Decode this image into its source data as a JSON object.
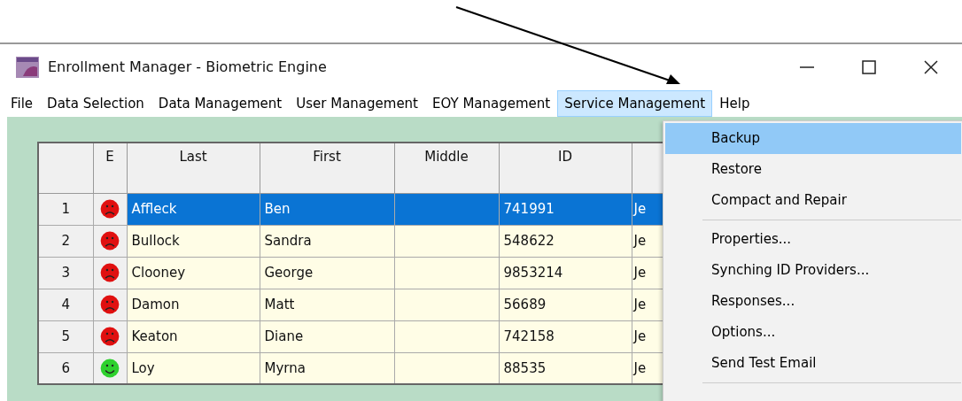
{
  "window": {
    "title": "Enrollment Manager - Biometric Engine"
  },
  "menu_bar": [
    {
      "label": "File",
      "selected": false
    },
    {
      "label": "Data Selection",
      "selected": false
    },
    {
      "label": "Data Management",
      "selected": false
    },
    {
      "label": "User Management",
      "selected": false
    },
    {
      "label": "EOY Management",
      "selected": false
    },
    {
      "label": "Service Management",
      "selected": true
    },
    {
      "label": "Help",
      "selected": false
    }
  ],
  "table": {
    "columns": [
      "",
      "E",
      "Last",
      "First",
      "Middle",
      "ID",
      ""
    ],
    "rows": [
      {
        "number": "1",
        "kind": "sad",
        "last": "Affleck",
        "first": "Ben",
        "middle": "",
        "id": "741991",
        "column_6": "Je",
        "selected": true
      },
      {
        "number": "2",
        "kind": "sad",
        "last": "Bullock",
        "first": "Sandra",
        "middle": "",
        "id": "548622",
        "column_6": "Je",
        "selected": false
      },
      {
        "number": "3",
        "kind": "sad",
        "last": "Clooney",
        "first": "George",
        "middle": "",
        "id": "9853214",
        "column_6": "Je",
        "selected": false
      },
      {
        "number": "4",
        "kind": "sad",
        "last": "Damon",
        "first": "Matt",
        "middle": "",
        "id": "56689",
        "column_6": "Je",
        "selected": false
      },
      {
        "number": "5",
        "kind": "sad",
        "last": "Keaton",
        "first": "Diane",
        "middle": "",
        "id": "742158",
        "column_6": "Je",
        "selected": false
      },
      {
        "number": "6",
        "kind": "happy",
        "last": "Loy",
        "first": "Myrna",
        "middle": "",
        "id": "88535",
        "column_6": "Je",
        "selected": false
      }
    ]
  },
  "dropdown_menu": {
    "items": [
      {
        "label": "Backup",
        "selected": true,
        "separator_after": false
      },
      {
        "label": "Restore",
        "selected": false,
        "separator_after": false
      },
      {
        "label": "Compact and Repair",
        "selected": false,
        "separator_after": true
      },
      {
        "label": "Properties...",
        "selected": false,
        "separator_after": false
      },
      {
        "label": "Synching ID Providers...",
        "selected": false,
        "separator_after": false
      },
      {
        "label": "Responses...",
        "selected": false,
        "separator_after": false
      },
      {
        "label": "Options...",
        "selected": false,
        "separator_after": false
      },
      {
        "label": "Send Test Email",
        "selected": false,
        "separator_after": true
      }
    ]
  }
}
